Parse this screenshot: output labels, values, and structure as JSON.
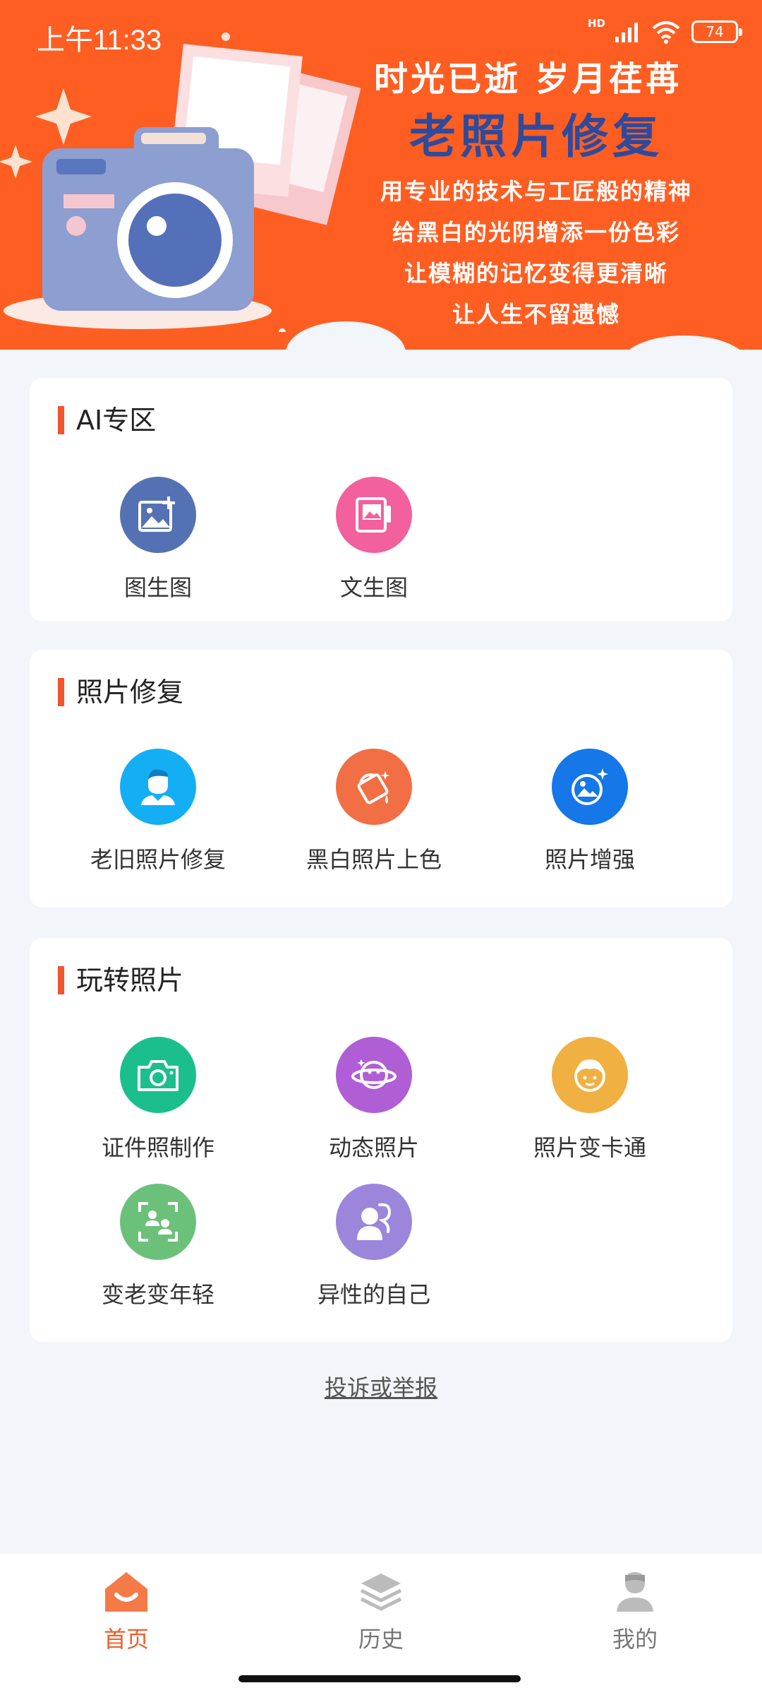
{
  "status_bar": {
    "time": "上午11:33",
    "battery": "74",
    "network": "HD"
  },
  "banner": {
    "title": "时光已逝  岁月荏苒",
    "subtitle": "老照片修复",
    "lines": [
      "用专业的技术与工匠般的精神",
      "给黑白的光阴增添一份色彩",
      "让模糊的记忆变得更清晰",
      "让人生不留遗憾"
    ]
  },
  "sections": [
    {
      "title": "AI专区",
      "items": [
        {
          "label": "图生图",
          "icon": "image-plus-icon",
          "color": "#5472b3"
        },
        {
          "label": "文生图",
          "icon": "photo-frame-icon",
          "color": "#f2609e"
        }
      ]
    },
    {
      "title": "照片修复",
      "items": [
        {
          "label": "老旧照片修复",
          "icon": "person-icon",
          "color": "#14aef5"
        },
        {
          "label": "黑白照片上色",
          "icon": "paint-bucket-icon",
          "color": "#f26e44"
        },
        {
          "label": "照片增强",
          "icon": "image-sparkle-icon",
          "color": "#1577e8"
        }
      ]
    },
    {
      "title": "玩转照片",
      "items": [
        {
          "label": "证件照制作",
          "icon": "camera-icon",
          "color": "#1bbf8d"
        },
        {
          "label": "动态照片",
          "icon": "planet-face-icon",
          "color": "#b05ed6"
        },
        {
          "label": "照片变卡通",
          "icon": "cartoon-face-icon",
          "color": "#f0b042"
        },
        {
          "label": "变老变年轻",
          "icon": "age-scan-icon",
          "color": "#6cc17a"
        },
        {
          "label": "异性的自己",
          "icon": "profile-swap-icon",
          "color": "#9b86dc"
        }
      ]
    }
  ],
  "report_link": "投诉或举报",
  "bottom_nav": [
    {
      "label": "首页",
      "icon": "home-icon",
      "active": true
    },
    {
      "label": "历史",
      "icon": "layers-icon",
      "active": false
    },
    {
      "label": "我的",
      "icon": "user-icon",
      "active": false
    }
  ],
  "colors": {
    "accent": "#ff5e22",
    "background": "#f2f5f9",
    "title_blue": "#2f4a9b"
  }
}
